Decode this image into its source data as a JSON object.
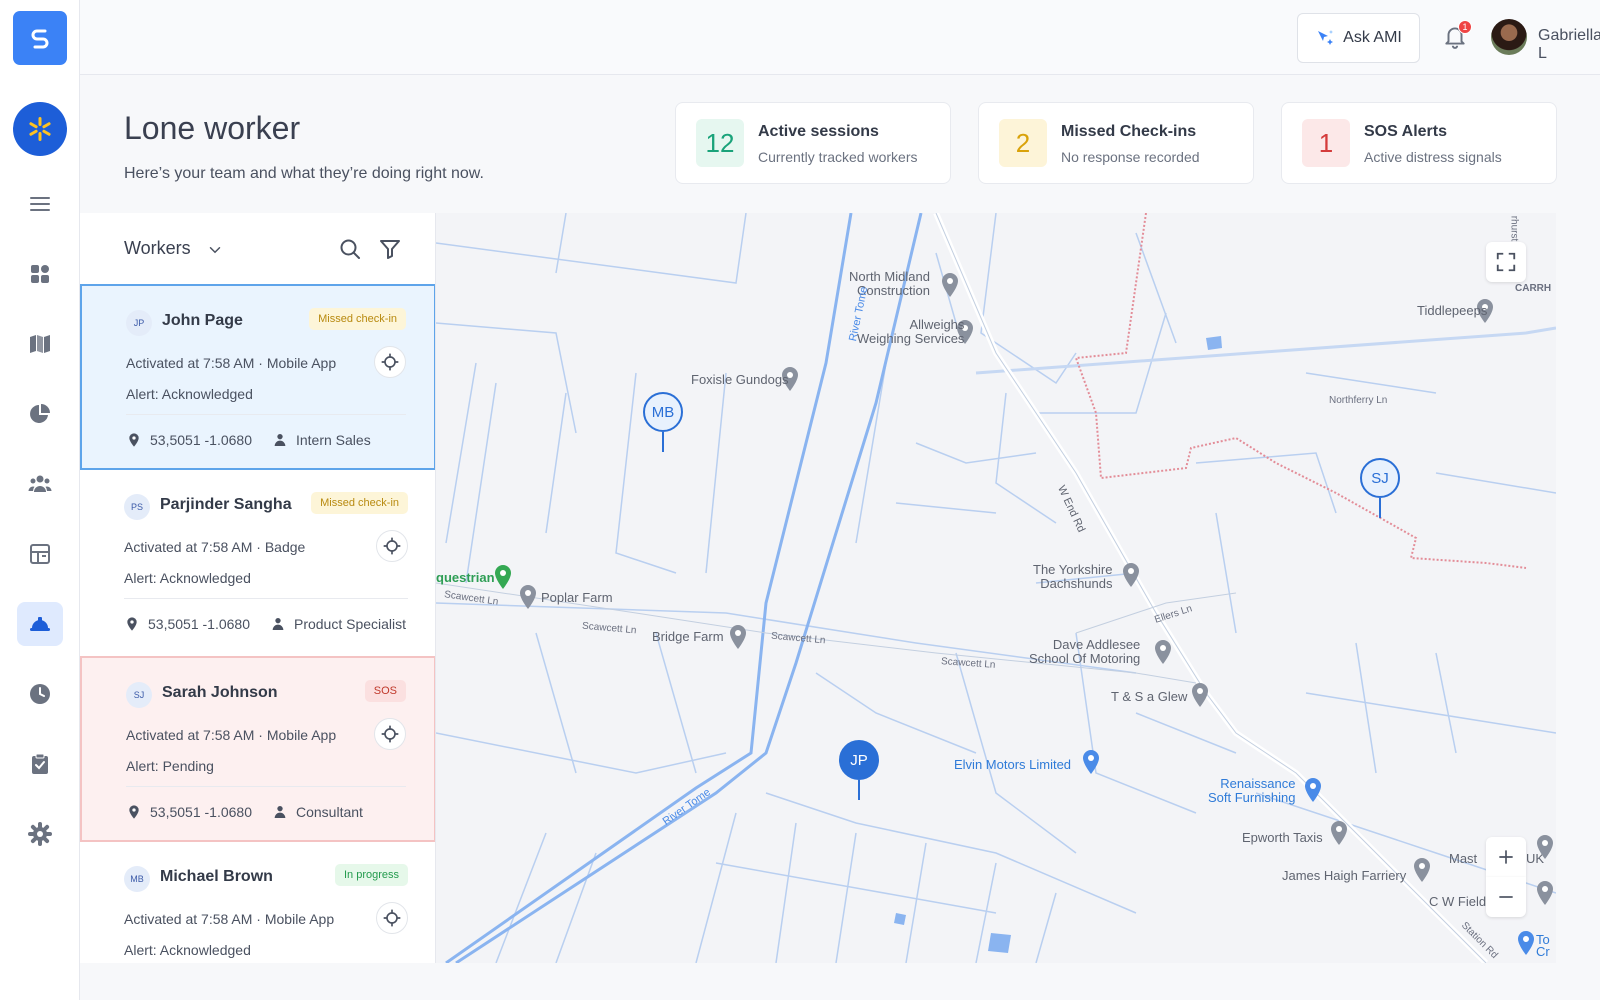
{
  "user": {
    "name": "Gabriella L",
    "notifications": "1"
  },
  "topbar": {
    "ask_label": "Ask AMI"
  },
  "header": {
    "title": "Lone worker",
    "subtitle": "Here’s your team and what they’re doing right now."
  },
  "stats": [
    {
      "value": "12",
      "title": "Active sessions",
      "subtitle": "Currently tracked workers",
      "color": "#1aa37a",
      "bg": "#e6f7f0"
    },
    {
      "value": "2",
      "title": "Missed Check-ins",
      "subtitle": "No response recorded",
      "color": "#d9a20a",
      "bg": "#fdf4d8"
    },
    {
      "value": "1",
      "title": "SOS Alerts",
      "subtitle": "Active distress signals",
      "color": "#d43b3b",
      "bg": "#fce8e8"
    }
  ],
  "panel": {
    "title": "Workers"
  },
  "workers": [
    {
      "initials": "JP",
      "name": "John Page",
      "badge": "Missed check-in",
      "activated": "Activated at 7:58 AM · Mobile App",
      "alert": "Alert: Acknowledged",
      "coords": "53,5051 -1.0680",
      "role": "Intern Sales"
    },
    {
      "initials": "PS",
      "name": "Parjinder Sangha",
      "badge": "Missed check-in",
      "activated": "Activated at 7:58 AM · Badge",
      "alert": "Alert: Acknowledged",
      "coords": "53,5051 -1.0680",
      "role": "Product Specialist"
    },
    {
      "initials": "SJ",
      "name": "Sarah Johnson",
      "badge": "SOS",
      "activated": "Activated at 7:58 AM · Mobile App",
      "alert": "Alert: Pending",
      "coords": "53,5051 -1.0680",
      "role": "Consultant"
    },
    {
      "initials": "MB",
      "name": "Michael Brown",
      "badge": "In progress",
      "activated": "Activated at 7:58 AM · Mobile App",
      "alert": "Alert: Acknowledged"
    }
  ],
  "map": {
    "pins": [
      "MB",
      "SJ",
      "JP"
    ],
    "places": {
      "north_midland": "North Midland\nConstruction",
      "allweighs": "Allweighs\nWeighing Services",
      "tiddlypeeps": "Tiddlepeeps",
      "carrh": "CARRH",
      "foxisle": "Foxisle Gundogs",
      "questrian": "questrian",
      "poplar": "Poplar Farm",
      "bridge": "Bridge Farm",
      "yorkshire": "The Yorkshire\nDachshunds",
      "dave": "Dave Addlesee\nSchool Of Motoring",
      "tsa": "T & S a Glew",
      "elvin": "Elvin Motors Limited",
      "renaissance": "Renaissance\nSoft Furnishing",
      "epworth": "Epworth Taxis",
      "james": "James Haigh Farriery",
      "mast": "Mast",
      "uk": "UK",
      "cwfield": "C W Field",
      "to": "To\nCr"
    },
    "roads": {
      "river_tome_top": "River Tome",
      "river_tome_bottom": "River Tome",
      "w_end_rd": "W End Rd",
      "scawcett1": "Scawcett Ln",
      "scawcett2": "Scawcett Ln",
      "scawcett3": "Scawcett Ln",
      "scawcett4": "Scawcett Ln",
      "northferry": "Northferry Ln",
      "ellers": "Ellers Ln",
      "station": "Station Rd",
      "ihurst": "rhurst"
    }
  }
}
